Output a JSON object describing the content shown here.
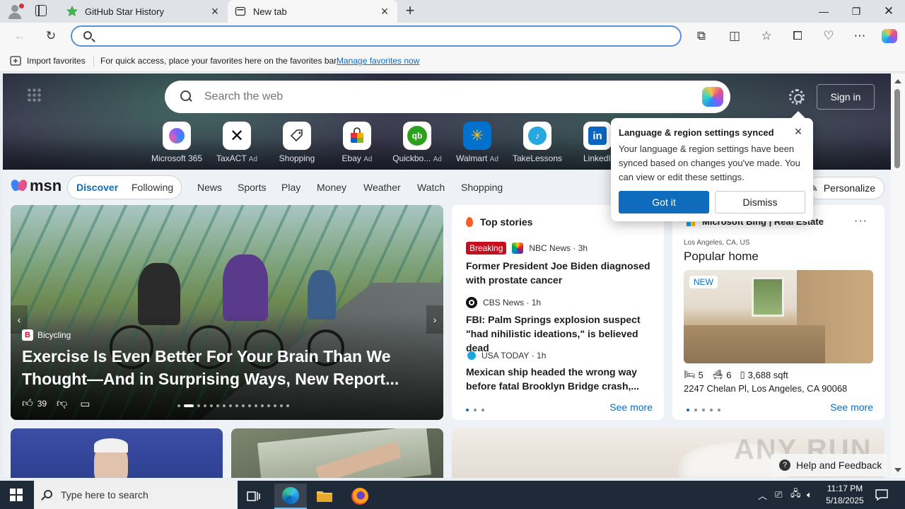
{
  "browser": {
    "tabs": [
      {
        "title": "GitHub Star History",
        "favicon": "star-history-icon"
      },
      {
        "title": "New tab",
        "favicon": "newtab-page-icon"
      }
    ],
    "omnibox": {
      "value": "",
      "placeholder": ""
    },
    "favorites_bar": {
      "import_label": "Import favorites",
      "message": "For quick access, place your favorites here on the favorites bar.",
      "manage_link": "Manage favorites now"
    }
  },
  "newtab": {
    "search_placeholder": "Search the web",
    "sign_in": "Sign in",
    "quick_links": [
      {
        "name": "Microsoft 365",
        "ad": ""
      },
      {
        "name": "TaxACT",
        "ad": "Ad"
      },
      {
        "name": "Shopping",
        "ad": ""
      },
      {
        "name": "Ebay",
        "ad": "Ad"
      },
      {
        "name": "Quickbo...",
        "ad": "Ad"
      },
      {
        "name": "Walmart",
        "ad": "Ad"
      },
      {
        "name": "TakeLessons",
        "ad": ""
      },
      {
        "name": "LinkedIn",
        "ad": ""
      }
    ],
    "msn": {
      "logo": "msn",
      "discover": "Discover",
      "following": "Following",
      "nav": [
        "News",
        "Sports",
        "Play",
        "Money",
        "Weather",
        "Watch",
        "Shopping"
      ],
      "personalize": "Personalize"
    },
    "hero_card": {
      "source": "Bicycling",
      "source_logo": "B",
      "headline": "Exercise Is Even Better For Your Brain Than We Thought—And in Surprising Ways, New Report...",
      "likes": "39"
    },
    "top_stories": {
      "heading": "Top stories",
      "stories": [
        {
          "badge": "Breaking",
          "publisher": "NBC News",
          "age": "3h",
          "title": "Former President Joe Biden diagnosed with prostate cancer"
        },
        {
          "badge": "",
          "publisher": "CBS News",
          "age": "1h",
          "title": "FBI: Palm Springs explosion suspect \"had nihilistic ideations,\" is believed dead"
        },
        {
          "badge": "",
          "publisher": "USA TODAY",
          "age": "1h",
          "title": "Mexican ship headed the wrong way before fatal Brooklyn Bridge crash,..."
        }
      ],
      "see_more": "See more"
    },
    "real_estate": {
      "heading": "Microsoft Bing | Real Estate",
      "location": "Los Angeles, CA, US",
      "title": "Popular home",
      "badge": "NEW",
      "beds": "5",
      "baths": "6",
      "sqft": "3,688 sqft",
      "address": "2247 Chelan Pl, Los Angeles, CA 90068",
      "see_more": "See more"
    }
  },
  "popup": {
    "title": "Language & region settings synced",
    "body": "Your language & region settings have been synced based on changes you've made. You can view or edit these settings.",
    "primary": "Got it",
    "secondary": "Dismiss"
  },
  "help": "Help and Feedback",
  "watermark": "ANY RUN",
  "taskbar": {
    "search_placeholder": "Type here to search",
    "time": "11:17 PM",
    "date": "5/18/2025"
  },
  "colors": {
    "accent": "#0f6cbd",
    "breaking": "#c50f1f",
    "omnibox_border": "#5b8fd6"
  }
}
